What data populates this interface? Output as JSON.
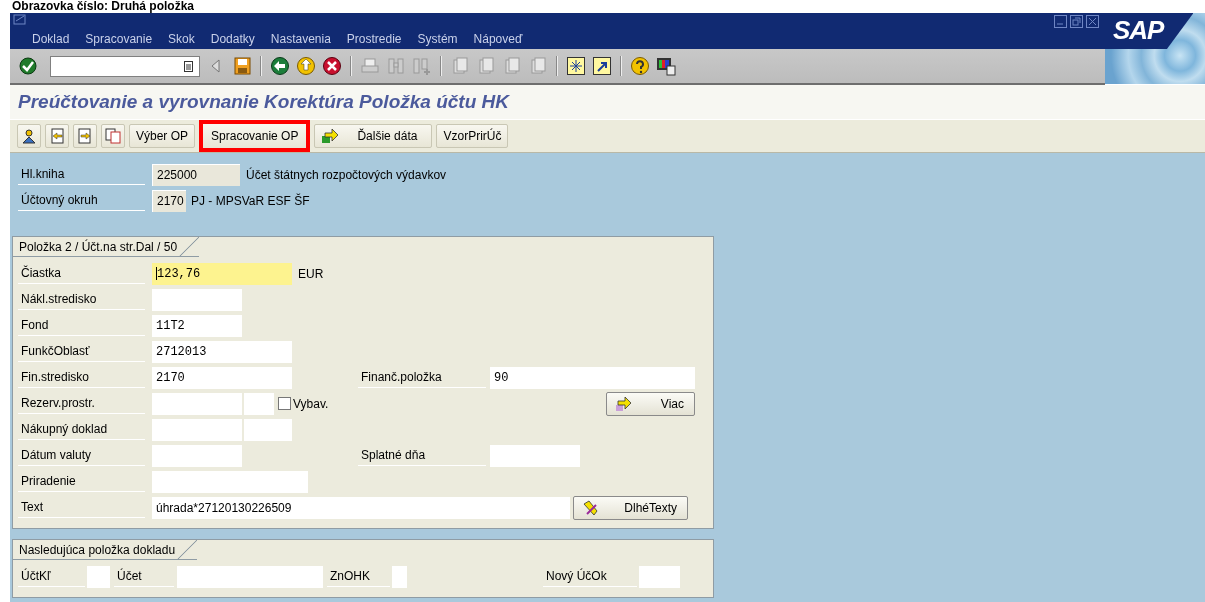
{
  "screen_caption": "Obrazovka číslo: Druhá položka",
  "menu": [
    {
      "label": "Doklad"
    },
    {
      "label": "Spracovanie"
    },
    {
      "label": "Skok"
    },
    {
      "label": "Dodatky"
    },
    {
      "label": "Nastavenia"
    },
    {
      "label": "Prostredie"
    },
    {
      "label": "Systém"
    },
    {
      "label": "Nápoveď"
    }
  ],
  "logo": "SAP",
  "title": "Preúčtovanie a vyrovnanie Korektúra Položka účtu HK",
  "app_toolbar": [
    {
      "kind": "icon"
    },
    {
      "kind": "icon"
    },
    {
      "kind": "icon"
    },
    {
      "kind": "icon"
    },
    {
      "kind": "text",
      "label": "Výber OP",
      "highlighted": false
    },
    {
      "kind": "text",
      "label": "Spracovanie OP",
      "highlighted": true
    },
    {
      "kind": "icon_text",
      "label": "Ďalšie dáta",
      "highlighted": false
    },
    {
      "kind": "text",
      "label": "VzorPrirÚč",
      "highlighted": false
    }
  ],
  "header_fields": [
    {
      "label": "Hl.kniha",
      "value": "225000",
      "description": "Účet štátnych rozpočtových výdavkov"
    },
    {
      "label": "Účtovný okruh",
      "value": "2170",
      "description": "PJ - MPSVaR ESF ŠF"
    }
  ],
  "item_group": {
    "title": "Položka 2 / Účt.na str.Dal / 50",
    "rows": [
      {
        "label": "Čiastka",
        "fields": [
          {
            "value": "123,76",
            "focused": true
          }
        ],
        "unit": "EUR"
      },
      {
        "label": "Nákl.stredisko",
        "fields": [
          {
            "focused": false
          }
        ]
      },
      {
        "label": "Fond",
        "fields": [
          {
            "value": "11T2",
            "focused": false
          }
        ]
      },
      {
        "label": "FunkčOblasť",
        "fields": [
          {
            "value": "2712013",
            "focused": false
          }
        ]
      },
      {
        "label": "Fin.stredisko",
        "fields": [
          {
            "value": "2170",
            "focused": false
          }
        ],
        "second_label": "Finanč.položka",
        "second_field": {
          "value": "90",
          "focused": false
        }
      },
      {
        "label": "Rezerv.prostr.",
        "fields": [
          {
            "focused": false
          },
          {
            "focused": false
          }
        ],
        "checkbox": {
          "label": "Vybav.",
          "checked": false
        },
        "button": "Viac"
      },
      {
        "label": "Nákupný doklad",
        "fields": [
          {
            "focused": false
          },
          {
            "focused": false
          }
        ]
      },
      {
        "label": "Dátum valuty",
        "fields": [
          {
            "focused": false
          }
        ],
        "second_label": "Splatné dňa",
        "second_field": {
          "focused": false
        }
      },
      {
        "label": "Priradenie",
        "fields": [
          {
            "focused": false
          }
        ]
      },
      {
        "label": "Text",
        "fields": [
          {
            "value": "úhrada*27120130226509",
            "focused": false
          }
        ],
        "button": "DlhéTexty"
      }
    ]
  },
  "next_item_group": {
    "title": "Nasledujúca položka dokladu",
    "fields": [
      {
        "label": "ÚčtKľ",
        "focused": false
      },
      {
        "label": "Účet",
        "focused": false
      },
      {
        "label": "ZnOHK",
        "focused": false
      },
      {
        "label": "Nový ÚčOk",
        "focused": false
      }
    ]
  }
}
